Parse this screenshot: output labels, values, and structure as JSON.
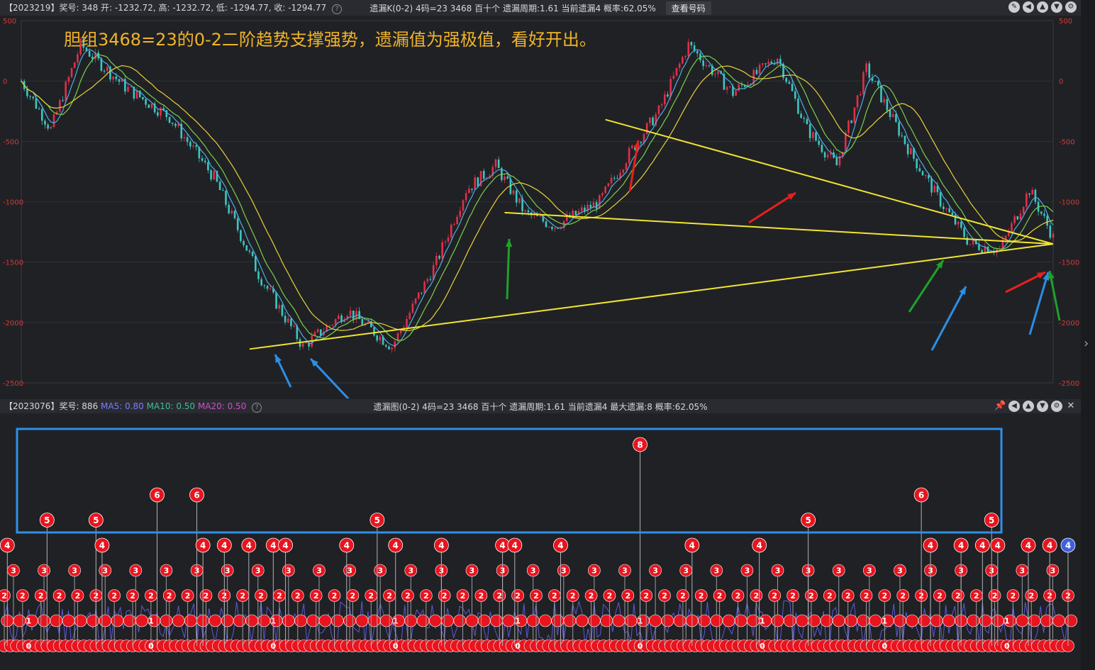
{
  "top_bar": {
    "left_text": "【2023219】奖号: 348  开: -1232.72, 高: -1232.72, 低: -1294.77, 收: -1294.77",
    "center_text": "遗漏K(0-2)  4码=23  3468  百十个  遗漏周期:1.61  当前遗漏4  概率:62.05%",
    "view_button": "查看号码",
    "help_icon": "?"
  },
  "bottom_bar": {
    "left_text": "【2023076】奖号: 886",
    "ma5_label": "MA5: 0.80",
    "ma10_label": "MA10: 0.50",
    "ma20_label": "MA20: 0.50",
    "center_text": "遗漏图(0-2)  4码=23  3468  百十个  遗漏周期:1.61  当前遗漏4  最大遗漏:8  概率:62.05%",
    "help_icon": "?"
  },
  "colors": {
    "background": "#202125",
    "grid": "#3a3c42",
    "candle_up": "#e0304a",
    "candle_down": "#3dc6c0",
    "ma_yellow": "#e8d23a",
    "ma_green": "#7ad14b",
    "trend_line": "#f2e530",
    "annotation_text": "#f0b429",
    "highlight_box": "#2f8fe8",
    "ball_red": "#e8141e",
    "ball_blue": "#3f5fe0",
    "arrow_red": "#e8201c",
    "arrow_green": "#1fa12a",
    "arrow_blue": "#2b8fe6"
  },
  "annotation": "胆组3468=23的0-2二阶趋势支撑强势，遗漏值为强极值，看好开出。",
  "side_arrow": "›",
  "chart_data": [
    {
      "type": "line",
      "name": "遗漏K线",
      "ylim": [
        -2500,
        500
      ],
      "y_ticks": [
        "500",
        "0",
        "-500",
        "-1000",
        "-1500",
        "-2000",
        "-2500"
      ],
      "x": [
        0,
        10,
        20,
        35,
        50,
        65,
        80,
        95,
        110,
        125,
        140,
        150,
        160,
        170,
        180,
        195,
        205,
        215,
        225,
        240,
        255,
        265,
        275,
        285,
        300,
        310,
        320,
        330,
        340,
        348
      ],
      "values": [
        0,
        -400,
        300,
        -50,
        -300,
        -800,
        -1600,
        -2200,
        -1900,
        -2200,
        -1500,
        -900,
        -700,
        -1100,
        -1200,
        -1000,
        -600,
        -250,
        300,
        -100,
        200,
        -400,
        -700,
        100,
        -600,
        -1000,
        -1350,
        -1400,
        -900,
        -1295
      ],
      "last": {
        "open": -1232.72,
        "high": -1232.72,
        "low": -1294.77,
        "close": -1294.77
      },
      "trend_lines": [
        {
          "from": [
            77,
            -2220
          ],
          "to": [
            348,
            -1350
          ]
        },
        {
          "from": [
            163,
            -1090
          ],
          "to": [
            348,
            -1350
          ]
        },
        {
          "from": [
            197,
            -320
          ],
          "to": [
            348,
            -1350
          ]
        }
      ]
    },
    {
      "type": "scatter",
      "name": "遗漏图",
      "ylim": [
        0,
        8
      ],
      "peaks": [
        {
          "x": 1,
          "v": 4
        },
        {
          "x": 14,
          "v": 5
        },
        {
          "x": 30,
          "v": 5
        },
        {
          "x": 32,
          "v": 4
        },
        {
          "x": 50,
          "v": 6
        },
        {
          "x": 63,
          "v": 6
        },
        {
          "x": 65,
          "v": 4
        },
        {
          "x": 72,
          "v": 4
        },
        {
          "x": 80,
          "v": 4
        },
        {
          "x": 88,
          "v": 4
        },
        {
          "x": 92,
          "v": 4
        },
        {
          "x": 112,
          "v": 4
        },
        {
          "x": 122,
          "v": 5
        },
        {
          "x": 128,
          "v": 4
        },
        {
          "x": 143,
          "v": 4
        },
        {
          "x": 163,
          "v": 4
        },
        {
          "x": 167,
          "v": 4
        },
        {
          "x": 182,
          "v": 4
        },
        {
          "x": 208,
          "v": 8
        },
        {
          "x": 225,
          "v": 4
        },
        {
          "x": 247,
          "v": 4
        },
        {
          "x": 263,
          "v": 5
        },
        {
          "x": 300,
          "v": 6
        },
        {
          "x": 303,
          "v": 4
        },
        {
          "x": 313,
          "v": 4
        },
        {
          "x": 320,
          "v": 4
        },
        {
          "x": 323,
          "v": 5
        },
        {
          "x": 325,
          "v": 4
        },
        {
          "x": 335,
          "v": 4
        },
        {
          "x": 342,
          "v": 4
        },
        {
          "x": 348,
          "v": 4
        }
      ],
      "current_value": 4,
      "threshold_box": {
        "min_value": 5,
        "max_value": 8
      }
    }
  ]
}
